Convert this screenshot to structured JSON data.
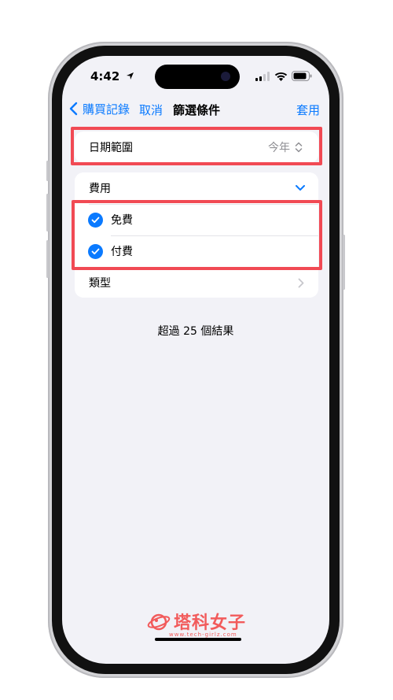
{
  "status_bar": {
    "time": "4:42"
  },
  "nav": {
    "back_label": "購買記錄",
    "cancel_label": "取消",
    "title": "篩選條件",
    "apply_label": "套用"
  },
  "date_range": {
    "label": "日期範圍",
    "value": "今年"
  },
  "fee": {
    "label": "費用",
    "options": [
      {
        "label": "免費",
        "checked": true
      },
      {
        "label": "付費",
        "checked": true
      }
    ]
  },
  "type": {
    "label": "類型"
  },
  "results_text": "超過 25 個結果",
  "watermark": {
    "title": "塔科女子",
    "subtitle": "www.tech-girlz.com"
  },
  "colors": {
    "accent": "#0a7aff",
    "highlight": "#f14a54",
    "background": "#f2f2f7"
  }
}
